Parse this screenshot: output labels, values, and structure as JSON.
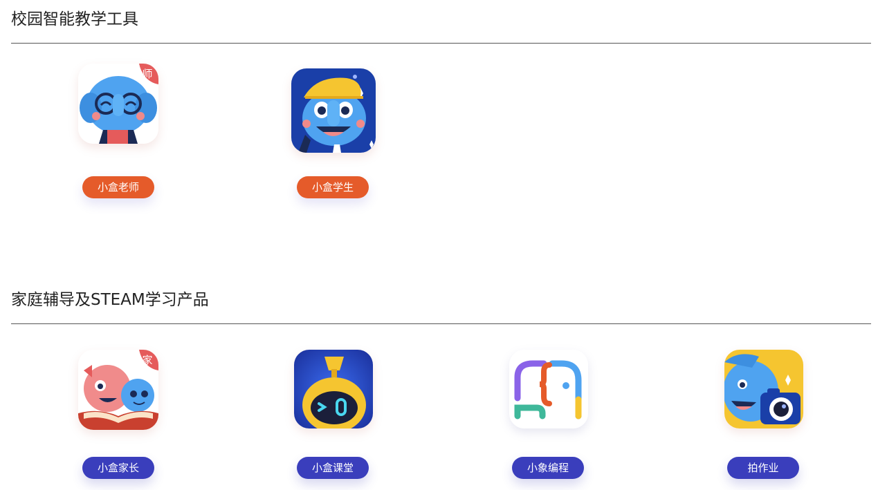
{
  "sections": [
    {
      "title": "校园智能教学工具",
      "apps": [
        {
          "label": "小盒老师",
          "badge": "师",
          "icon": "elephant-teacher-icon"
        },
        {
          "label": "小盒学生",
          "icon": "elephant-student-icon"
        }
      ]
    },
    {
      "title": "家庭辅导及STEAM学习产品",
      "apps": [
        {
          "label": "小盒家长",
          "badge": "家",
          "icon": "elephant-parent-icon"
        },
        {
          "label": "小盒课堂",
          "icon": "robot-classroom-icon"
        },
        {
          "label": "小象编程",
          "icon": "elephant-coding-icon"
        },
        {
          "label": "拍作业",
          "icon": "elephant-camera-icon"
        }
      ]
    }
  ],
  "colors": {
    "pill_orange": "#e55b2a",
    "pill_blue": "#3a3ebc",
    "badge_red": "#e55b5b",
    "elephant_blue": "#4fa3f0"
  }
}
